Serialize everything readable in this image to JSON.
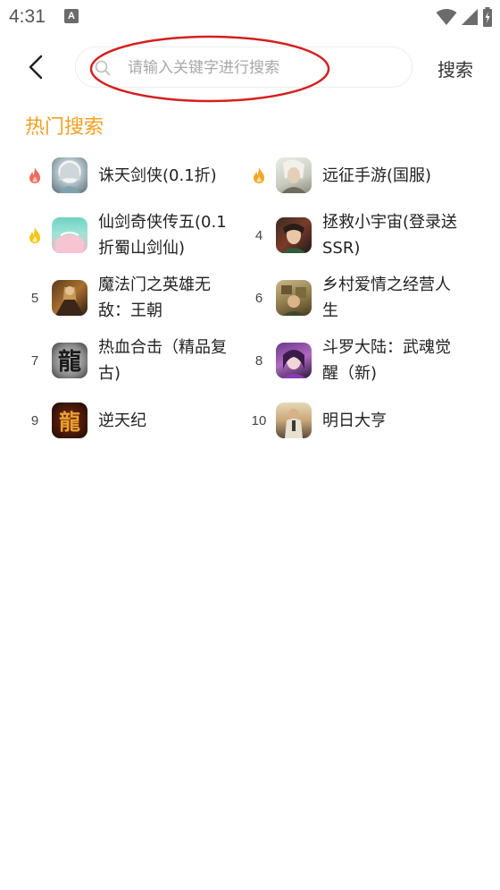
{
  "status_bar": {
    "time": "4:31",
    "notification_icon": "A",
    "icons": [
      "wifi-icon",
      "cell-signal-icon",
      "battery-icon"
    ]
  },
  "search": {
    "placeholder": "请输入关键字进行搜索",
    "value": "",
    "button_label": "搜索"
  },
  "hot_search": {
    "title": "热门搜索",
    "items": [
      {
        "rank": "",
        "rank_icon": "fire-icon",
        "rank_color": "#f06a60",
        "name": "诛天剑侠(0.1折)"
      },
      {
        "rank": "",
        "rank_icon": "fire-icon",
        "rank_color": "#f5a623",
        "name": "远征手游(国服)"
      },
      {
        "rank": "",
        "rank_icon": "fire-icon",
        "rank_color": "#f5c518",
        "name": "仙剑奇侠传五(0.1折蜀山剑仙)"
      },
      {
        "rank": "4",
        "name": "拯救小宇宙(登录送SSR)"
      },
      {
        "rank": "5",
        "name": "魔法门之英雄无敌：王朝"
      },
      {
        "rank": "6",
        "name": "乡村爱情之经营人生"
      },
      {
        "rank": "7",
        "name": "热血合击（精品复古)"
      },
      {
        "rank": "8",
        "name": "斗罗大陆：武魂觉醒（新)"
      },
      {
        "rank": "9",
        "name": "逆天纪"
      },
      {
        "rank": "10",
        "name": "明日大亨"
      }
    ]
  },
  "colors": {
    "accent": "#f0a020",
    "annotation": "#d42020"
  }
}
